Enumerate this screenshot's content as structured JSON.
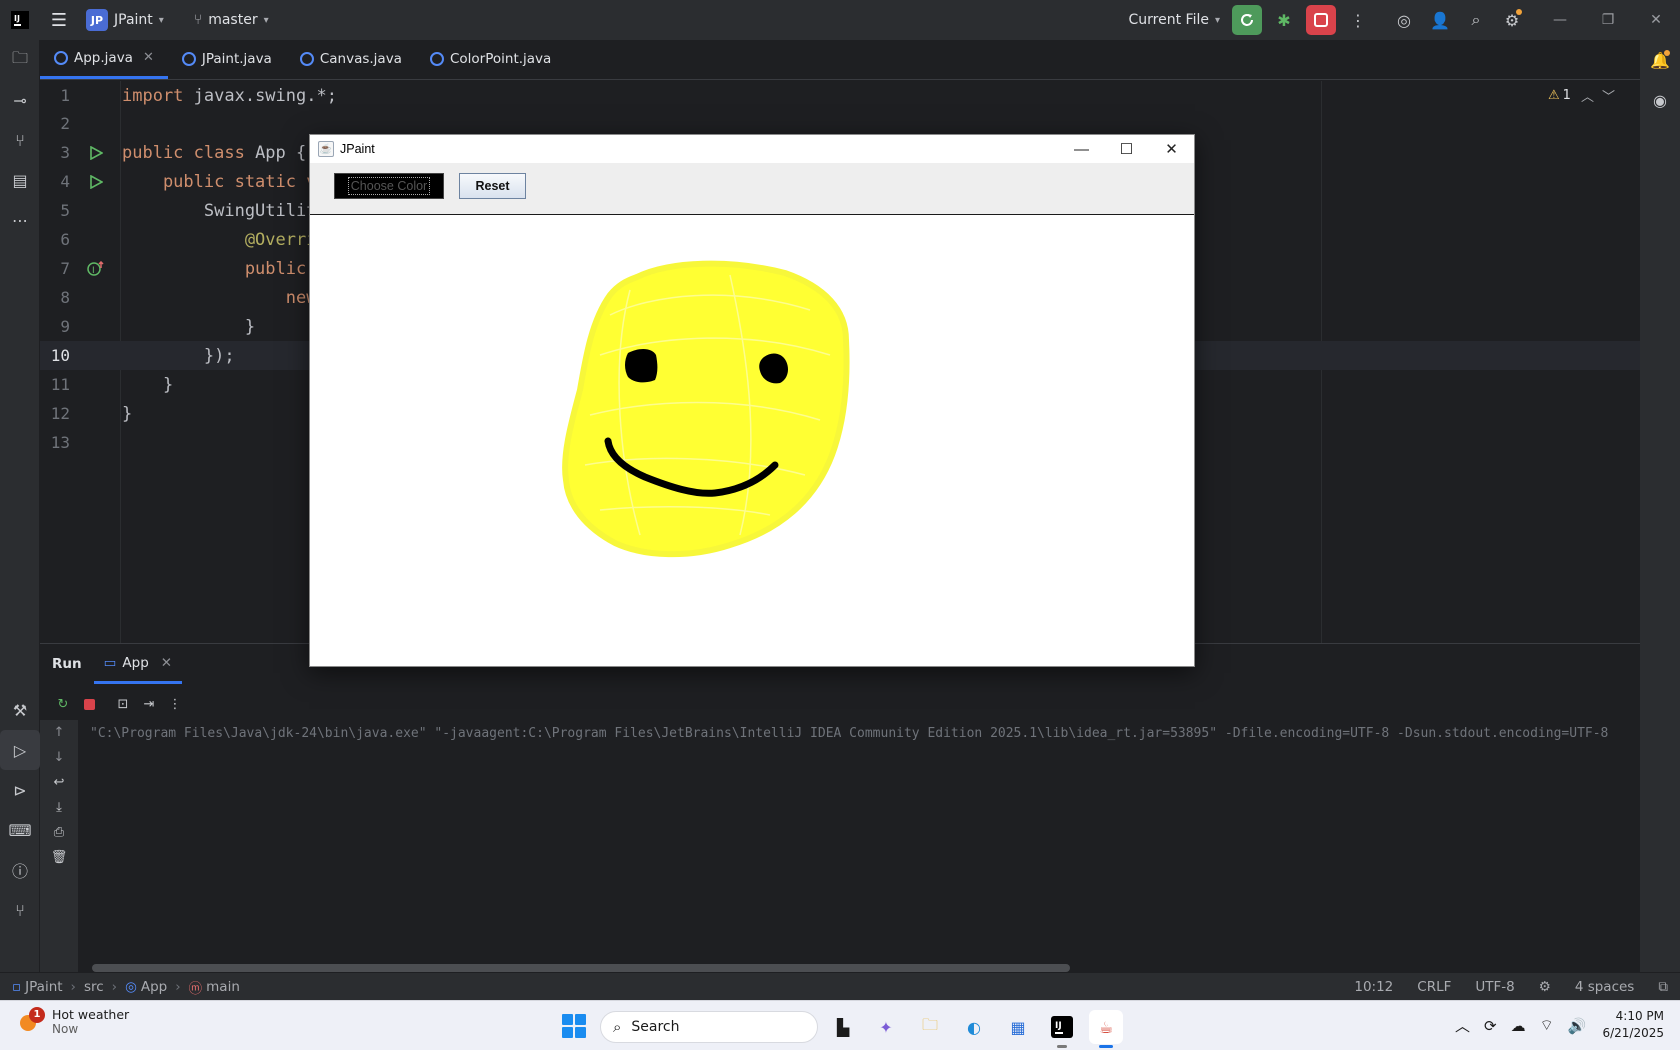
{
  "titlebar": {
    "project_badge": "JP",
    "project_name": "JPaint",
    "branch": "master",
    "run_config": "Current File"
  },
  "editor_tabs": [
    {
      "label": "App.java",
      "active": true
    },
    {
      "label": "JPaint.java",
      "active": false
    },
    {
      "label": "Canvas.java",
      "active": false
    },
    {
      "label": "ColorPoint.java",
      "active": false
    }
  ],
  "editor": {
    "line_numbers": [
      "1",
      "2",
      "3",
      "4",
      "5",
      "6",
      "7",
      "8",
      "9",
      "10",
      "11",
      "12",
      "13"
    ],
    "current_line": "10",
    "warning_count": "1",
    "lines": {
      "l1_kw": "import",
      "l1_rest": " javax.swing.*;",
      "l3_kw": "public class",
      "l3_rest": " App {",
      "l4_kw": "    public static v",
      "l5_rest": "        SwingUtilit",
      "l6_ann": "            @Overri",
      "l7_kw": "            public ",
      "l8_kw": "                new",
      "l9_rest": "            }",
      "l10_rest": "        });",
      "l11_rest": "    }",
      "l12_rest": "}"
    }
  },
  "jpaint": {
    "title": "JPaint",
    "choose_color_label": "Choose Color",
    "reset_label": "Reset"
  },
  "run_panel": {
    "title": "Run",
    "tab_label": "App",
    "console_line": "\"C:\\Program Files\\Java\\jdk-24\\bin\\java.exe\" \"-javaagent:C:\\Program Files\\JetBrains\\IntelliJ IDEA Community Edition 2025.1\\lib\\idea_rt.jar=53895\" -Dfile.encoding=UTF-8 -Dsun.stdout.encoding=UTF-8"
  },
  "statusbar": {
    "crumbs": [
      "JPaint",
      "src",
      "App",
      "main"
    ],
    "position": "10:12",
    "line_sep": "CRLF",
    "encoding": "UTF-8",
    "indent": "4 spaces"
  },
  "taskbar": {
    "weather_badge": "1",
    "weather_title": "Hot weather",
    "weather_sub": "Now",
    "search_placeholder": "Search",
    "time": "4:10 PM",
    "date": "6/21/2025"
  },
  "colors": {
    "accent": "#3574f0",
    "run_green": "#4e9a5b",
    "stop_red": "#d9434b",
    "smiley_yellow": "#ffff33"
  }
}
